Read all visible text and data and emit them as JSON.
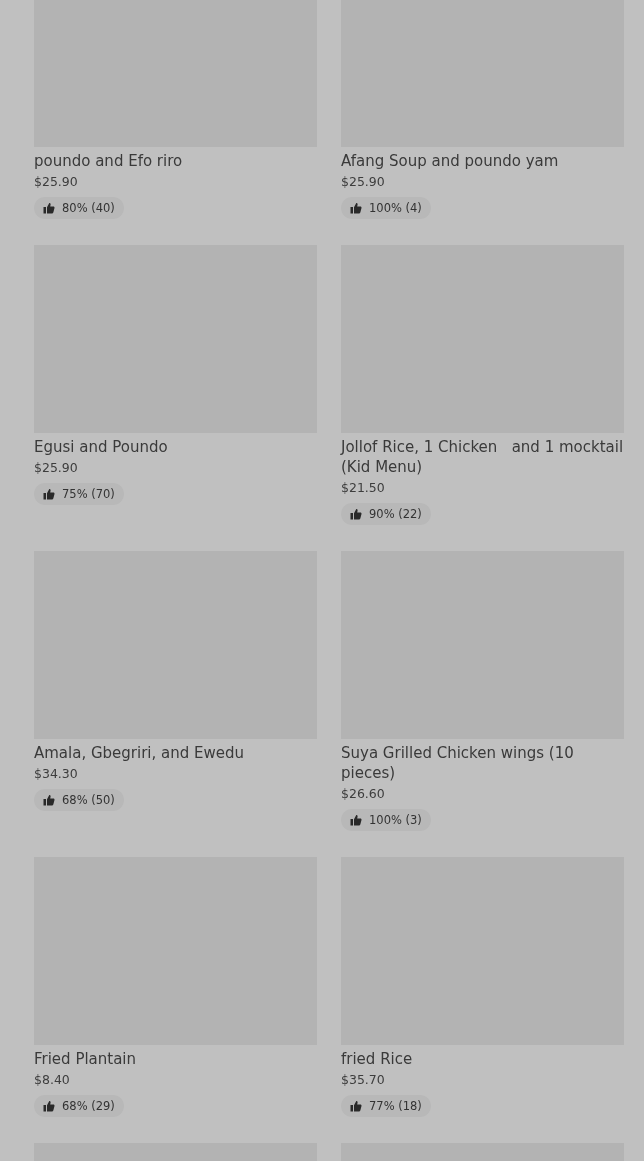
{
  "items": [
    {
      "kind": "placeholder",
      "name": "poundo and Efo riro",
      "price": "$25.90",
      "rating": "80% (40)"
    },
    {
      "kind": "placeholder",
      "name": "Afang Soup and poundo yam",
      "price": "$25.90",
      "rating": "100% (4)"
    },
    {
      "kind": "placeholder",
      "name": "Egusi and Poundo",
      "price": "$25.90",
      "rating": "75% (70)"
    },
    {
      "kind": "placeholder",
      "name": "Jollof Rice, 1 Chicken   and 1 mocktail (Kid Menu)",
      "price": "$21.50",
      "rating": "90% (22)"
    },
    {
      "kind": "placeholder",
      "name": "Amala, Gbegriri, and Ewedu",
      "price": "$34.30",
      "rating": "68% (50)"
    },
    {
      "kind": "placeholder",
      "name": "Suya Grilled Chicken wings (10 pieces)",
      "price": "$26.60",
      "rating": "100% (3)"
    },
    {
      "kind": "placeholder",
      "name": "Fried Plantain",
      "price": "$8.40",
      "rating": "68% (29)"
    },
    {
      "kind": "placeholder",
      "name": "fried Rice",
      "price": "$35.70",
      "rating": "77% (18)"
    },
    {
      "kind": "placeholder"
    },
    {
      "kind": "placeholder"
    }
  ]
}
